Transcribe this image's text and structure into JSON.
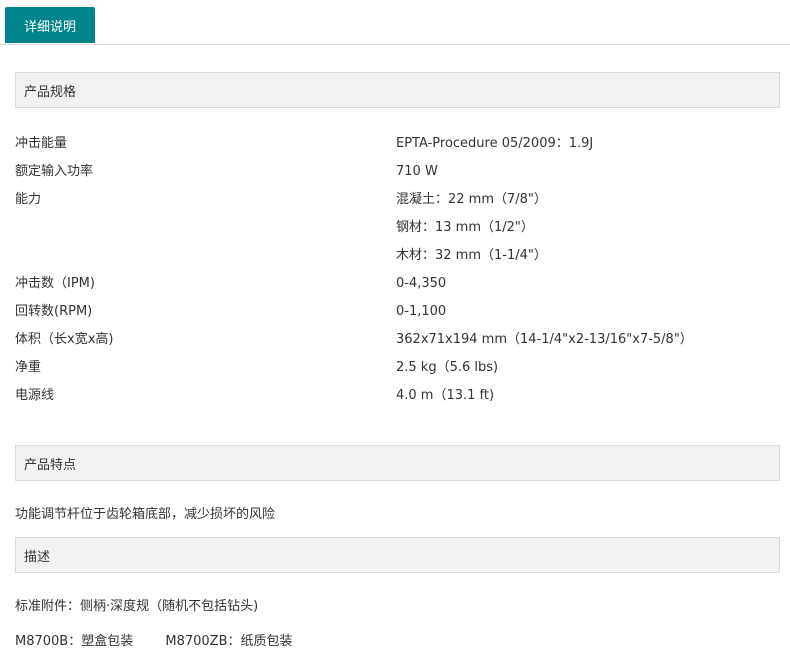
{
  "tabs": {
    "active_label": "详细说明"
  },
  "specs": {
    "header": "产品规格",
    "rows": [
      {
        "label": "冲击能量",
        "value": "EPTA-Procedure 05/2009：1.9J"
      },
      {
        "label": "额定输入功率",
        "value": "710 W"
      },
      {
        "label": "能力",
        "value": "混凝土：22 mm（7/8\"）"
      },
      {
        "label": "",
        "value": "钢材：13 mm（1/2\"）"
      },
      {
        "label": "",
        "value": "木材：32 mm（1-1/4\"）"
      },
      {
        "label": "冲击数（IPM)",
        "value": "0-4,350"
      },
      {
        "label": "回转数(RPM)",
        "value": "0-1,100"
      },
      {
        "label": "体积（长x宽x高)",
        "value": "362x71x194 mm（14-1/4\"x2-13/16\"x7-5/8\"）"
      },
      {
        "label": "净重",
        "value": "2.5 kg（5.6 lbs)"
      },
      {
        "label": "电源线",
        "value": "4.0 m（13.1 ft)"
      }
    ]
  },
  "features": {
    "header": "产品特点",
    "text": "功能调节杆位于齿轮箱底部，减少损坏的风险"
  },
  "description": {
    "header": "描述",
    "accessories": "标准附件：侧柄·深度规（随机不包括钻头)",
    "packaging": [
      "M8700B：塑盒包装",
      "M8700ZB：纸质包装"
    ]
  }
}
